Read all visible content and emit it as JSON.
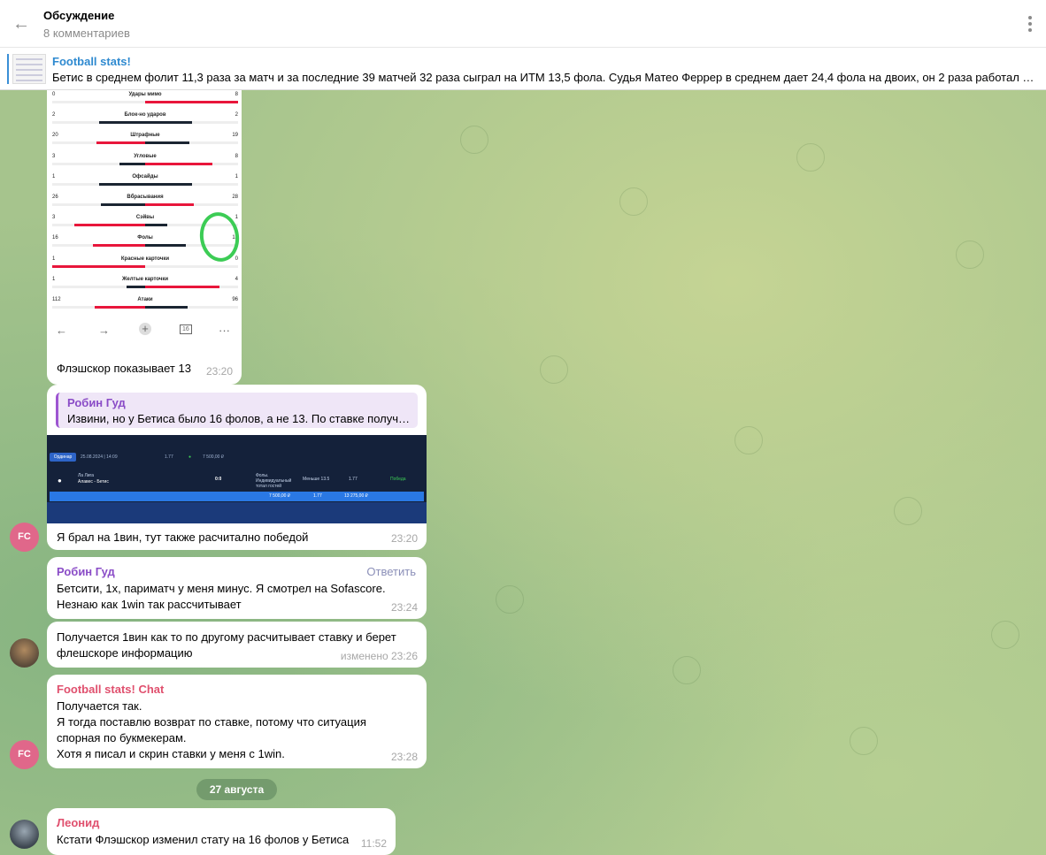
{
  "header": {
    "title": "Обсуждение",
    "subtitle": "8 комментариев"
  },
  "pinned": {
    "title": "Football stats!",
    "text": "Бетис в среднем фолит 11,3 раза за матч и за последние 39 матчей 32 раза сыграл на ИТМ 13,5 фола. Судья Матео Феррер в среднем дает 24,4 фола на двоих, он 2 раза работал на..."
  },
  "stats_image": {
    "rows": [
      {
        "label": "Удары мимо",
        "left": "0",
        "right": "8",
        "left_share": 0.0,
        "right_share": 0.5,
        "left_color": "red",
        "right_color": "red"
      },
      {
        "label": "Блок-но ударов",
        "left": "2",
        "right": "2",
        "left_share": 0.25,
        "right_share": 0.25,
        "left_color": "dark",
        "right_color": "dark"
      },
      {
        "label": "Штрафные",
        "left": "20",
        "right": "19",
        "left_share": 0.26,
        "right_share": 0.24,
        "left_color": "red",
        "right_color": "dark"
      },
      {
        "label": "Угловые",
        "left": "3",
        "right": "8",
        "left_share": 0.14,
        "right_share": 0.36,
        "left_color": "dark",
        "right_color": "red"
      },
      {
        "label": "Офсайды",
        "left": "1",
        "right": "1",
        "left_share": 0.25,
        "right_share": 0.25,
        "left_color": "dark",
        "right_color": "dark"
      },
      {
        "label": "Вбрасывания",
        "left": "26",
        "right": "28",
        "left_share": 0.24,
        "right_share": 0.26,
        "left_color": "dark",
        "right_color": "red"
      },
      {
        "label": "Сэйвы",
        "left": "3",
        "right": "1",
        "left_share": 0.38,
        "right_share": 0.12,
        "left_color": "red",
        "right_color": "dark"
      },
      {
        "label": "Фолы",
        "left": "16",
        "right": "13",
        "left_share": 0.28,
        "right_share": 0.22,
        "left_color": "red",
        "right_color": "dark"
      },
      {
        "label": "Красные карточки",
        "left": "1",
        "right": "0",
        "left_share": 0.5,
        "right_share": 0.0,
        "left_color": "red",
        "right_color": "red"
      },
      {
        "label": "Желтые карточки",
        "left": "1",
        "right": "4",
        "left_share": 0.1,
        "right_share": 0.4,
        "left_color": "dark",
        "right_color": "red"
      },
      {
        "label": "Атаки",
        "left": "112",
        "right": "96",
        "left_share": 0.27,
        "right_share": 0.23,
        "left_color": "red",
        "right_color": "dark"
      }
    ],
    "nav": [
      "←",
      "→",
      "+",
      "16",
      "···"
    ]
  },
  "messages": {
    "m1": {
      "text": "Флэшскор показывает 13",
      "time": "23:20"
    },
    "m2": {
      "quote_name": "Робин Гуд",
      "quote_text": "Извини, но у Бетиса было 16 фолов, а не 13. По ставке получа...",
      "text": "Я брал на 1вин, тут также расчитално победой",
      "time": "23:20",
      "avatar": "FC",
      "screenshot": {
        "tab": "Ординар",
        "date": "25.08.2024 | 14:09",
        "amount_top": "7 500,00 ₽",
        "league": "Ла Лига",
        "teams": "Алавес - Бетис",
        "score": "0:0",
        "market": "Фолы. Индивидуальный тотал гостей",
        "pick": "Меньше 13.5",
        "odd": "1.77",
        "status": "Победа",
        "bar_amount": "7 500,00 ₽",
        "bar_odd": "1.77",
        "bar_win": "13 275,00 ₽"
      }
    },
    "m3": {
      "name": "Робин Гуд",
      "reply": "Ответить",
      "lines": [
        "Бетсити, 1х, париматч  у меня минус. Я смотрел на  Sofascore.",
        "Незнаю как 1win так рассчитывает"
      ],
      "time": "23:24"
    },
    "m4": {
      "lines": [
        "Получается 1вин как то по другому расчитывает ставку и берет",
        "флешскоре информацию"
      ],
      "time": "изменено 23:26"
    },
    "m5": {
      "name": "Football stats! Chat",
      "lines": [
        "Получается так.",
        "Я тогда поставлю возврат по ставке, потому что ситуация",
        "спорная по букмекерам.",
        "Хотя я писал и скрин ставки у меня с 1win."
      ],
      "time": "23:28",
      "avatar": "FC"
    },
    "date_separator": "27 августа",
    "m6": {
      "name": "Леонид",
      "text": "Кстати Флэшскор изменил стату на 16 фолов у Бетиса",
      "time": "11:52"
    }
  },
  "colors": {
    "accent_blue": "#2f8ad0",
    "name_purple": "#8a4cc7",
    "name_red": "#e0506e",
    "name_pink": "#e0678a"
  }
}
